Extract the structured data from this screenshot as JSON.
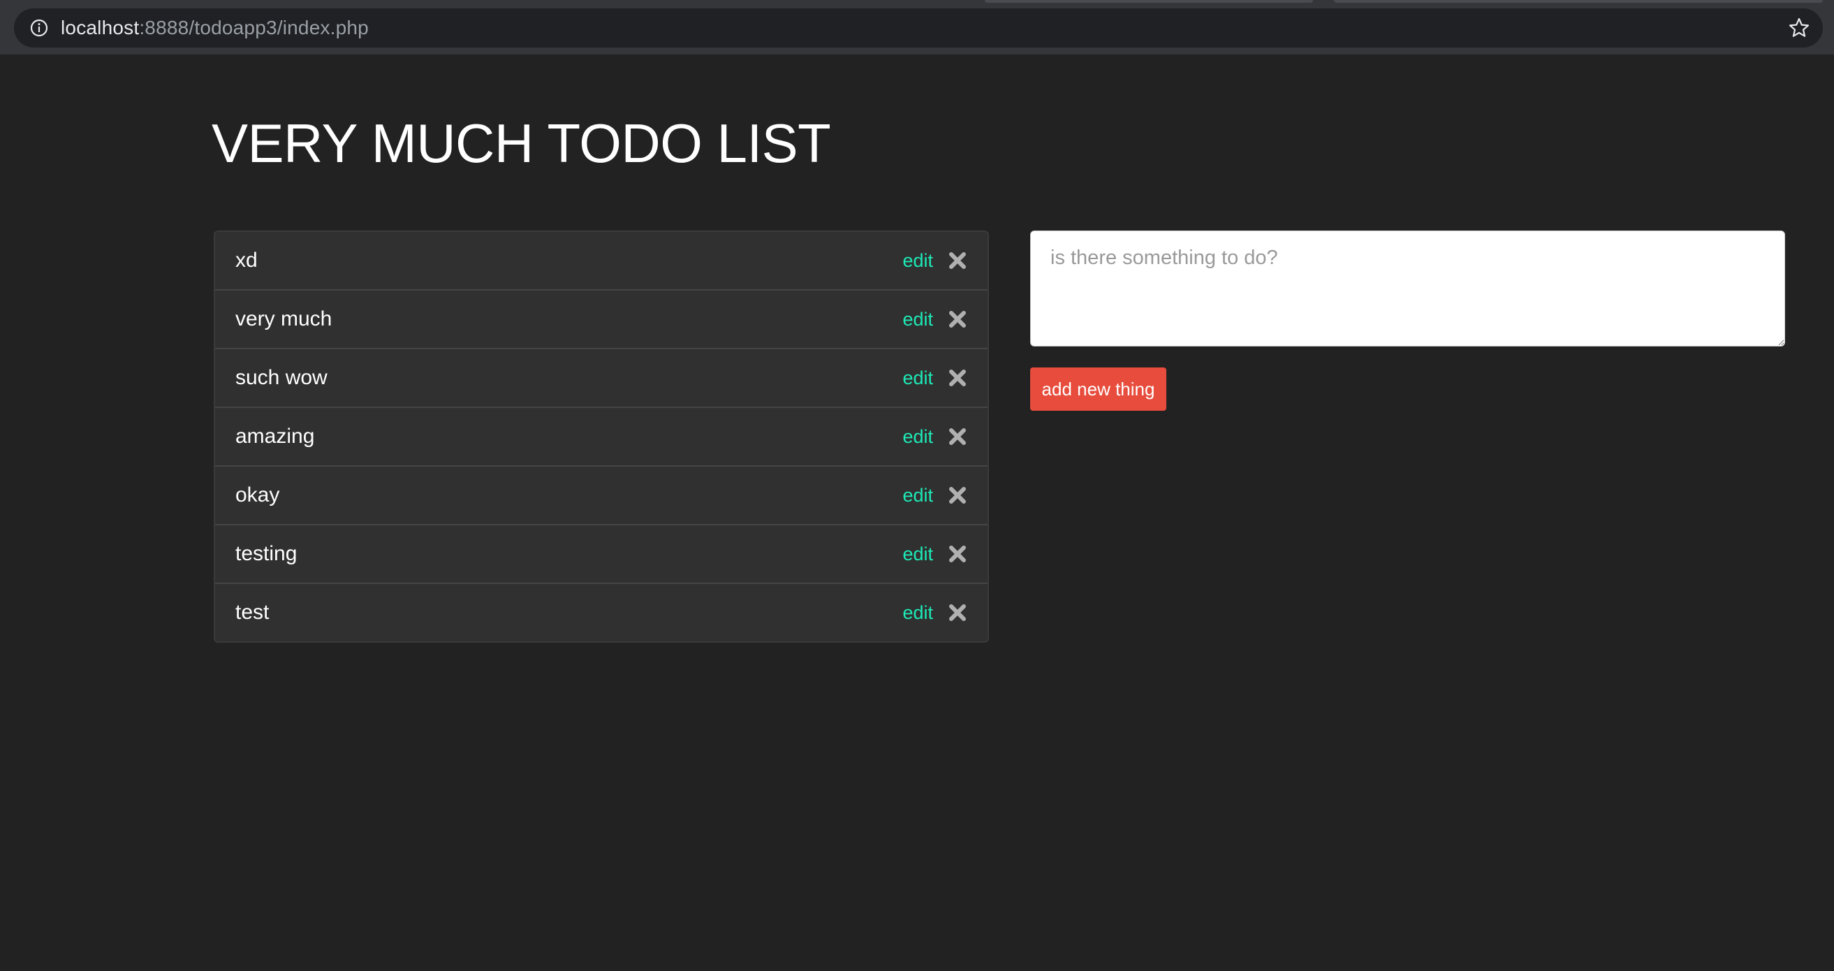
{
  "browser": {
    "url_host": "localhost",
    "url_rest": ":8888/todoapp3/index.php",
    "icons": {
      "site_info": "info-icon",
      "bookmark": "star-icon"
    }
  },
  "page": {
    "title": "VERY MUCH TODO LIST"
  },
  "todos": [
    {
      "text": "xd",
      "edit_label": "edit"
    },
    {
      "text": "very much",
      "edit_label": "edit"
    },
    {
      "text": "such wow",
      "edit_label": "edit"
    },
    {
      "text": "amazing",
      "edit_label": "edit"
    },
    {
      "text": "okay",
      "edit_label": "edit"
    },
    {
      "text": "testing",
      "edit_label": "edit"
    },
    {
      "text": "test",
      "edit_label": "edit"
    }
  ],
  "form": {
    "placeholder": "is there something to do?",
    "value": "",
    "submit_label": "add new thing"
  },
  "colors": {
    "background": "#222222",
    "list_bg": "#303030",
    "edit_link": "#1de9b6",
    "button": "#e74c3c"
  }
}
